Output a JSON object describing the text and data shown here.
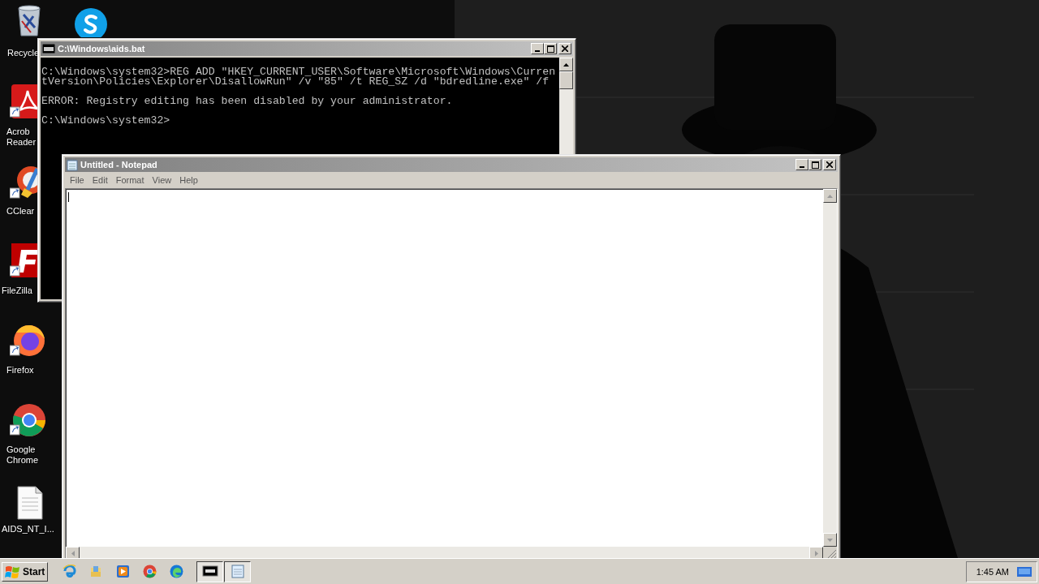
{
  "desktop": {
    "icons": [
      {
        "kind": "recycle",
        "lines": [
          "Recycle"
        ]
      },
      {
        "kind": "chat"
      },
      {
        "kind": "pdf",
        "lines": [
          "Acrob",
          "Reader"
        ]
      },
      {
        "kind": "cleaner",
        "lines": [
          "CClear"
        ]
      },
      {
        "kind": "ftp",
        "lines": [
          "FileZilla"
        ]
      },
      {
        "kind": "firefox",
        "lines": [
          "Firefox"
        ]
      },
      {
        "kind": "chrome",
        "lines": [
          "Google",
          "Chrome"
        ]
      },
      {
        "kind": "file",
        "lines": [
          "AIDS_NT_I..."
        ]
      }
    ]
  },
  "console": {
    "title": "C:\\Windows\\aids.bat",
    "blocks": [
      [
        "C:\\Windows\\system32>REG ADD \"HKEY_CURRENT_USER\\Software\\Microsoft\\Windows\\Curren",
        "tVersion\\Policies\\Explorer\\DisallowRun\" /v \"85\" /t REG_SZ /d \"bdredline.exe\" /f"
      ],
      [
        "ERROR: Registry editing has been disabled by your administrator."
      ],
      [
        "C:\\Windows\\system32>"
      ]
    ]
  },
  "notepad": {
    "title": "Untitled - Notepad",
    "menu": [
      "File",
      "Edit",
      "Format",
      "View",
      "Help"
    ]
  },
  "taskbar": {
    "start": "Start",
    "quick_launch": [
      {
        "kind": "ie"
      },
      {
        "kind": "folder"
      },
      {
        "kind": "media"
      },
      {
        "kind": "chrome"
      },
      {
        "kind": "edge"
      }
    ],
    "tasks": [
      {
        "kind": "console"
      },
      {
        "kind": "notepad"
      }
    ],
    "clock": "1:45 AM"
  }
}
